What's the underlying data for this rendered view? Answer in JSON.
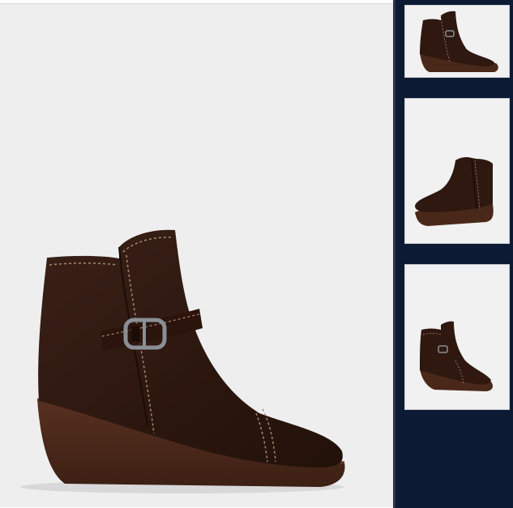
{
  "viewer": {
    "main_image": {
      "icon": "ankle-boot-icon",
      "boot_color": "#2f1810",
      "sole_color": "#4a2819",
      "stitch_color": "#a88a70",
      "buckle_color": "#8a8f96",
      "background": "#eeeeef"
    },
    "thumbnails": [
      {
        "icon": "ankle-boot-side-icon",
        "selected": true
      },
      {
        "icon": "ankle-boot-angle-icon",
        "selected": false
      },
      {
        "icon": "ankle-boot-front-icon",
        "selected": false
      }
    ],
    "rail_color": "#0d1a33"
  }
}
